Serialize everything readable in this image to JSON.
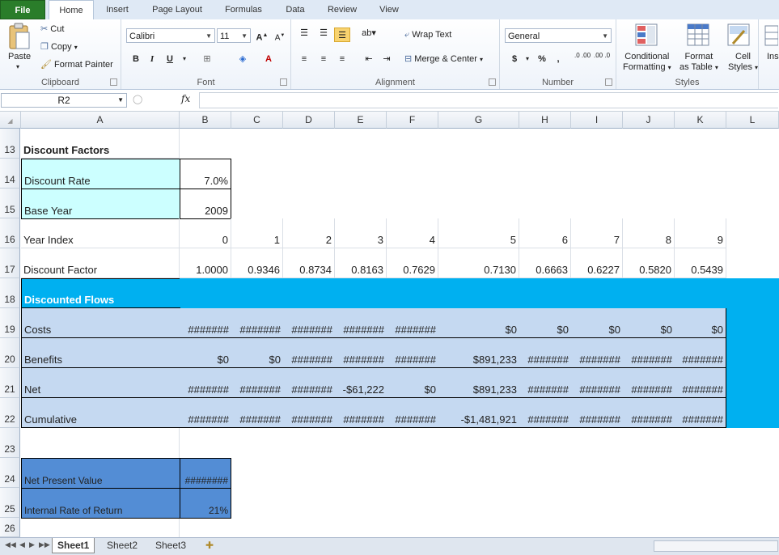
{
  "ribbon": {
    "tabs": [
      "File",
      "Home",
      "Insert",
      "Page Layout",
      "Formulas",
      "Data",
      "Review",
      "View"
    ],
    "clipboard": {
      "paste": "Paste",
      "cut": "Cut",
      "copy": "Copy",
      "format_painter": "Format Painter",
      "label": "Clipboard"
    },
    "font": {
      "name": "Calibri",
      "size": "11",
      "bold": "B",
      "italic": "I",
      "underline": "U",
      "label": "Font"
    },
    "alignment": {
      "wrap_text": "Wrap Text",
      "merge_center": "Merge & Center",
      "label": "Alignment"
    },
    "number": {
      "format": "General",
      "currency": "$",
      "percent": "%",
      "comma": ",",
      "inc_dec": ".0 .00",
      "dec_dec": ".00 .0",
      "label": "Number"
    },
    "styles": {
      "conditional": "Conditional",
      "conditional2": "Formatting",
      "format_table": "Format",
      "format_table2": "as Table",
      "cell_styles": "Cell",
      "cell_styles2": "Styles",
      "label": "Styles"
    },
    "insert_cut": "Ins"
  },
  "formula_bar": {
    "name_box": "R2",
    "fx": "fx",
    "value": ""
  },
  "columns": [
    "A",
    "B",
    "C",
    "D",
    "E",
    "F",
    "G",
    "H",
    "I",
    "J",
    "K",
    "L"
  ],
  "rows": {
    "r13": {
      "num": "13",
      "A": "Discount Factors"
    },
    "r14": {
      "num": "14",
      "A": "Discount Rate",
      "B": "7.0%"
    },
    "r15": {
      "num": "15",
      "A": "Base Year",
      "B": "2009"
    },
    "r16": {
      "num": "16",
      "A": "Year Index",
      "B": "0",
      "C": "1",
      "D": "2",
      "E": "3",
      "F": "4",
      "G": "5",
      "H": "6",
      "I": "7",
      "J": "8",
      "K": "9"
    },
    "r17": {
      "num": "17",
      "A": "Discount Factor",
      "B": "1.0000",
      "C": "0.9346",
      "D": "0.8734",
      "E": "0.8163",
      "F": "0.7629",
      "G": "0.7130",
      "H": "0.6663",
      "I": "0.6227",
      "J": "0.5820",
      "K": "0.5439"
    },
    "r18": {
      "num": "18",
      "A": "Discounted Flows"
    },
    "r19": {
      "num": "19",
      "A": "Costs",
      "B": "#######",
      "C": "#######",
      "D": "#######",
      "E": "#######",
      "F": "#######",
      "G": "$0",
      "H": "$0",
      "I": "$0",
      "J": "$0",
      "K": "$0"
    },
    "r20": {
      "num": "20",
      "A": "Benefits",
      "B": "$0",
      "C": "$0",
      "D": "#######",
      "E": "#######",
      "F": "#######",
      "G": "$891,233",
      "H": "#######",
      "I": "#######",
      "J": "#######",
      "K": "#######"
    },
    "r21": {
      "num": "21",
      "A": "Net",
      "B": "#######",
      "C": "#######",
      "D": "#######",
      "E": "-$61,222",
      "F": "$0",
      "G": "$891,233",
      "H": "#######",
      "I": "#######",
      "J": "#######",
      "K": "#######"
    },
    "r22": {
      "num": "22",
      "A": "Cumulative",
      "B": "#######",
      "C": "#######",
      "D": "#######",
      "E": "#######",
      "F": "#######",
      "G": "-$1,481,921",
      "H": "#######",
      "I": "#######",
      "J": "#######",
      "K": "#######"
    },
    "r23": {
      "num": "23"
    },
    "r24": {
      "num": "24",
      "A": "Net Present Value",
      "B": "########"
    },
    "r25": {
      "num": "25",
      "A": "Internal Rate of Return",
      "B": "21%"
    },
    "r26": {
      "num": "26"
    }
  },
  "sheets": [
    "Sheet1",
    "Sheet2",
    "Sheet3"
  ],
  "colors": {
    "cyan": "#ccffff",
    "bright_blue": "#00b0f0",
    "light_blue": "#c5d9f1",
    "medium_blue": "#538dd5",
    "file_green": "#2a7d2a"
  }
}
